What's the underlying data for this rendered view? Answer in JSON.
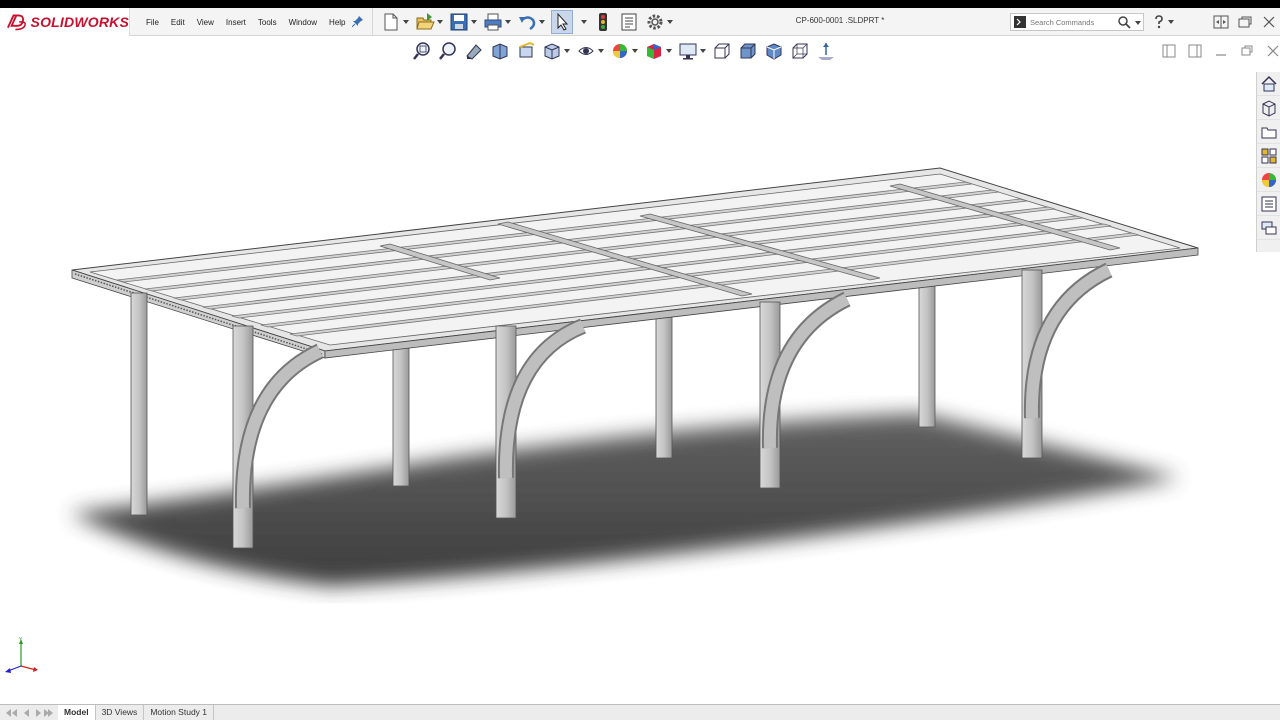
{
  "app": {
    "logo_text": "SOLIDWORKS",
    "brand_color": "#c8102e"
  },
  "menu": {
    "items": [
      "File",
      "Edit",
      "View",
      "Insert",
      "Tools",
      "Window",
      "Help"
    ]
  },
  "quickbar": {
    "icons": [
      "new-document-icon",
      "open-icon",
      "save-icon",
      "print-icon",
      "undo-icon",
      "select-icon",
      "rebuild-icon",
      "file-properties-icon",
      "options-icon"
    ]
  },
  "document": {
    "title": "CP-600-0001 .SLDPRT *"
  },
  "search": {
    "placeholder": "Search Commands"
  },
  "hud": {
    "icons": [
      "zoom-to-fit-icon",
      "zoom-to-area-icon",
      "previous-view-icon",
      "section-view-icon",
      "dynamic-annotation-icon",
      "view-orientation-icon",
      "display-style-icon",
      "hide-show-items-icon",
      "edit-appearance-icon",
      "apply-scene-icon",
      "view-settings-icon",
      "box-view-icon",
      "shaded-cube-icon",
      "isometric-cube-icon",
      "wireframe-cube-icon",
      "dimension-arrow-icon"
    ]
  },
  "taskpane": {
    "icons": [
      "home-icon",
      "design-library-icon",
      "file-explorer-icon",
      "view-palette-icon",
      "appearances-icon",
      "custom-properties-icon",
      "forum-icon"
    ]
  },
  "tabs": {
    "items": [
      "Model",
      "3D Views",
      "Motion Study 1"
    ],
    "active": "Model"
  },
  "colors": {
    "accent": "#c8102e",
    "shadow": "#3a3a3a",
    "steel": "#b8b8b8"
  }
}
